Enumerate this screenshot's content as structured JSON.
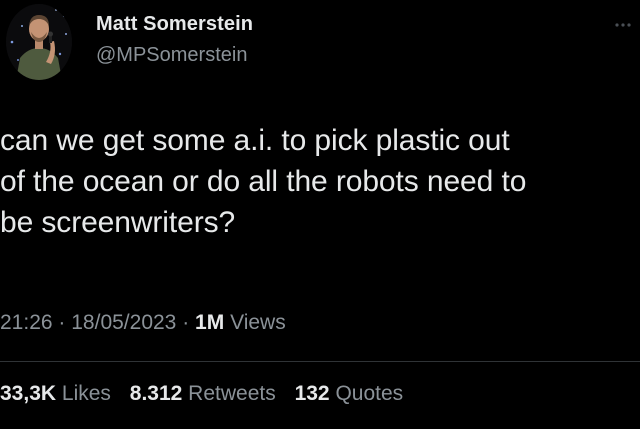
{
  "author": {
    "name": "Matt Somerstein",
    "handle": "@MPSomerstein",
    "avatar_icon": "profile-photo"
  },
  "tweet": {
    "text_lines": [
      "can we get some a.i. to pick plastic out",
      "of the ocean or do all the robots need to",
      "be screenwriters?"
    ]
  },
  "meta": {
    "time": "21:26",
    "separator": "·",
    "date": "18/05/2023",
    "views_count": "1M",
    "views_label": "Views"
  },
  "stats": {
    "likes_count": "33,3K",
    "likes_label": "Likes",
    "retweets_count": "8.312",
    "retweets_label": "Retweets",
    "quotes_count": "132",
    "quotes_label": "Quotes"
  },
  "colors": {
    "background": "#000000",
    "text": "#e7e9ea",
    "secondary": "#8b9298",
    "divider": "#2f3336"
  }
}
